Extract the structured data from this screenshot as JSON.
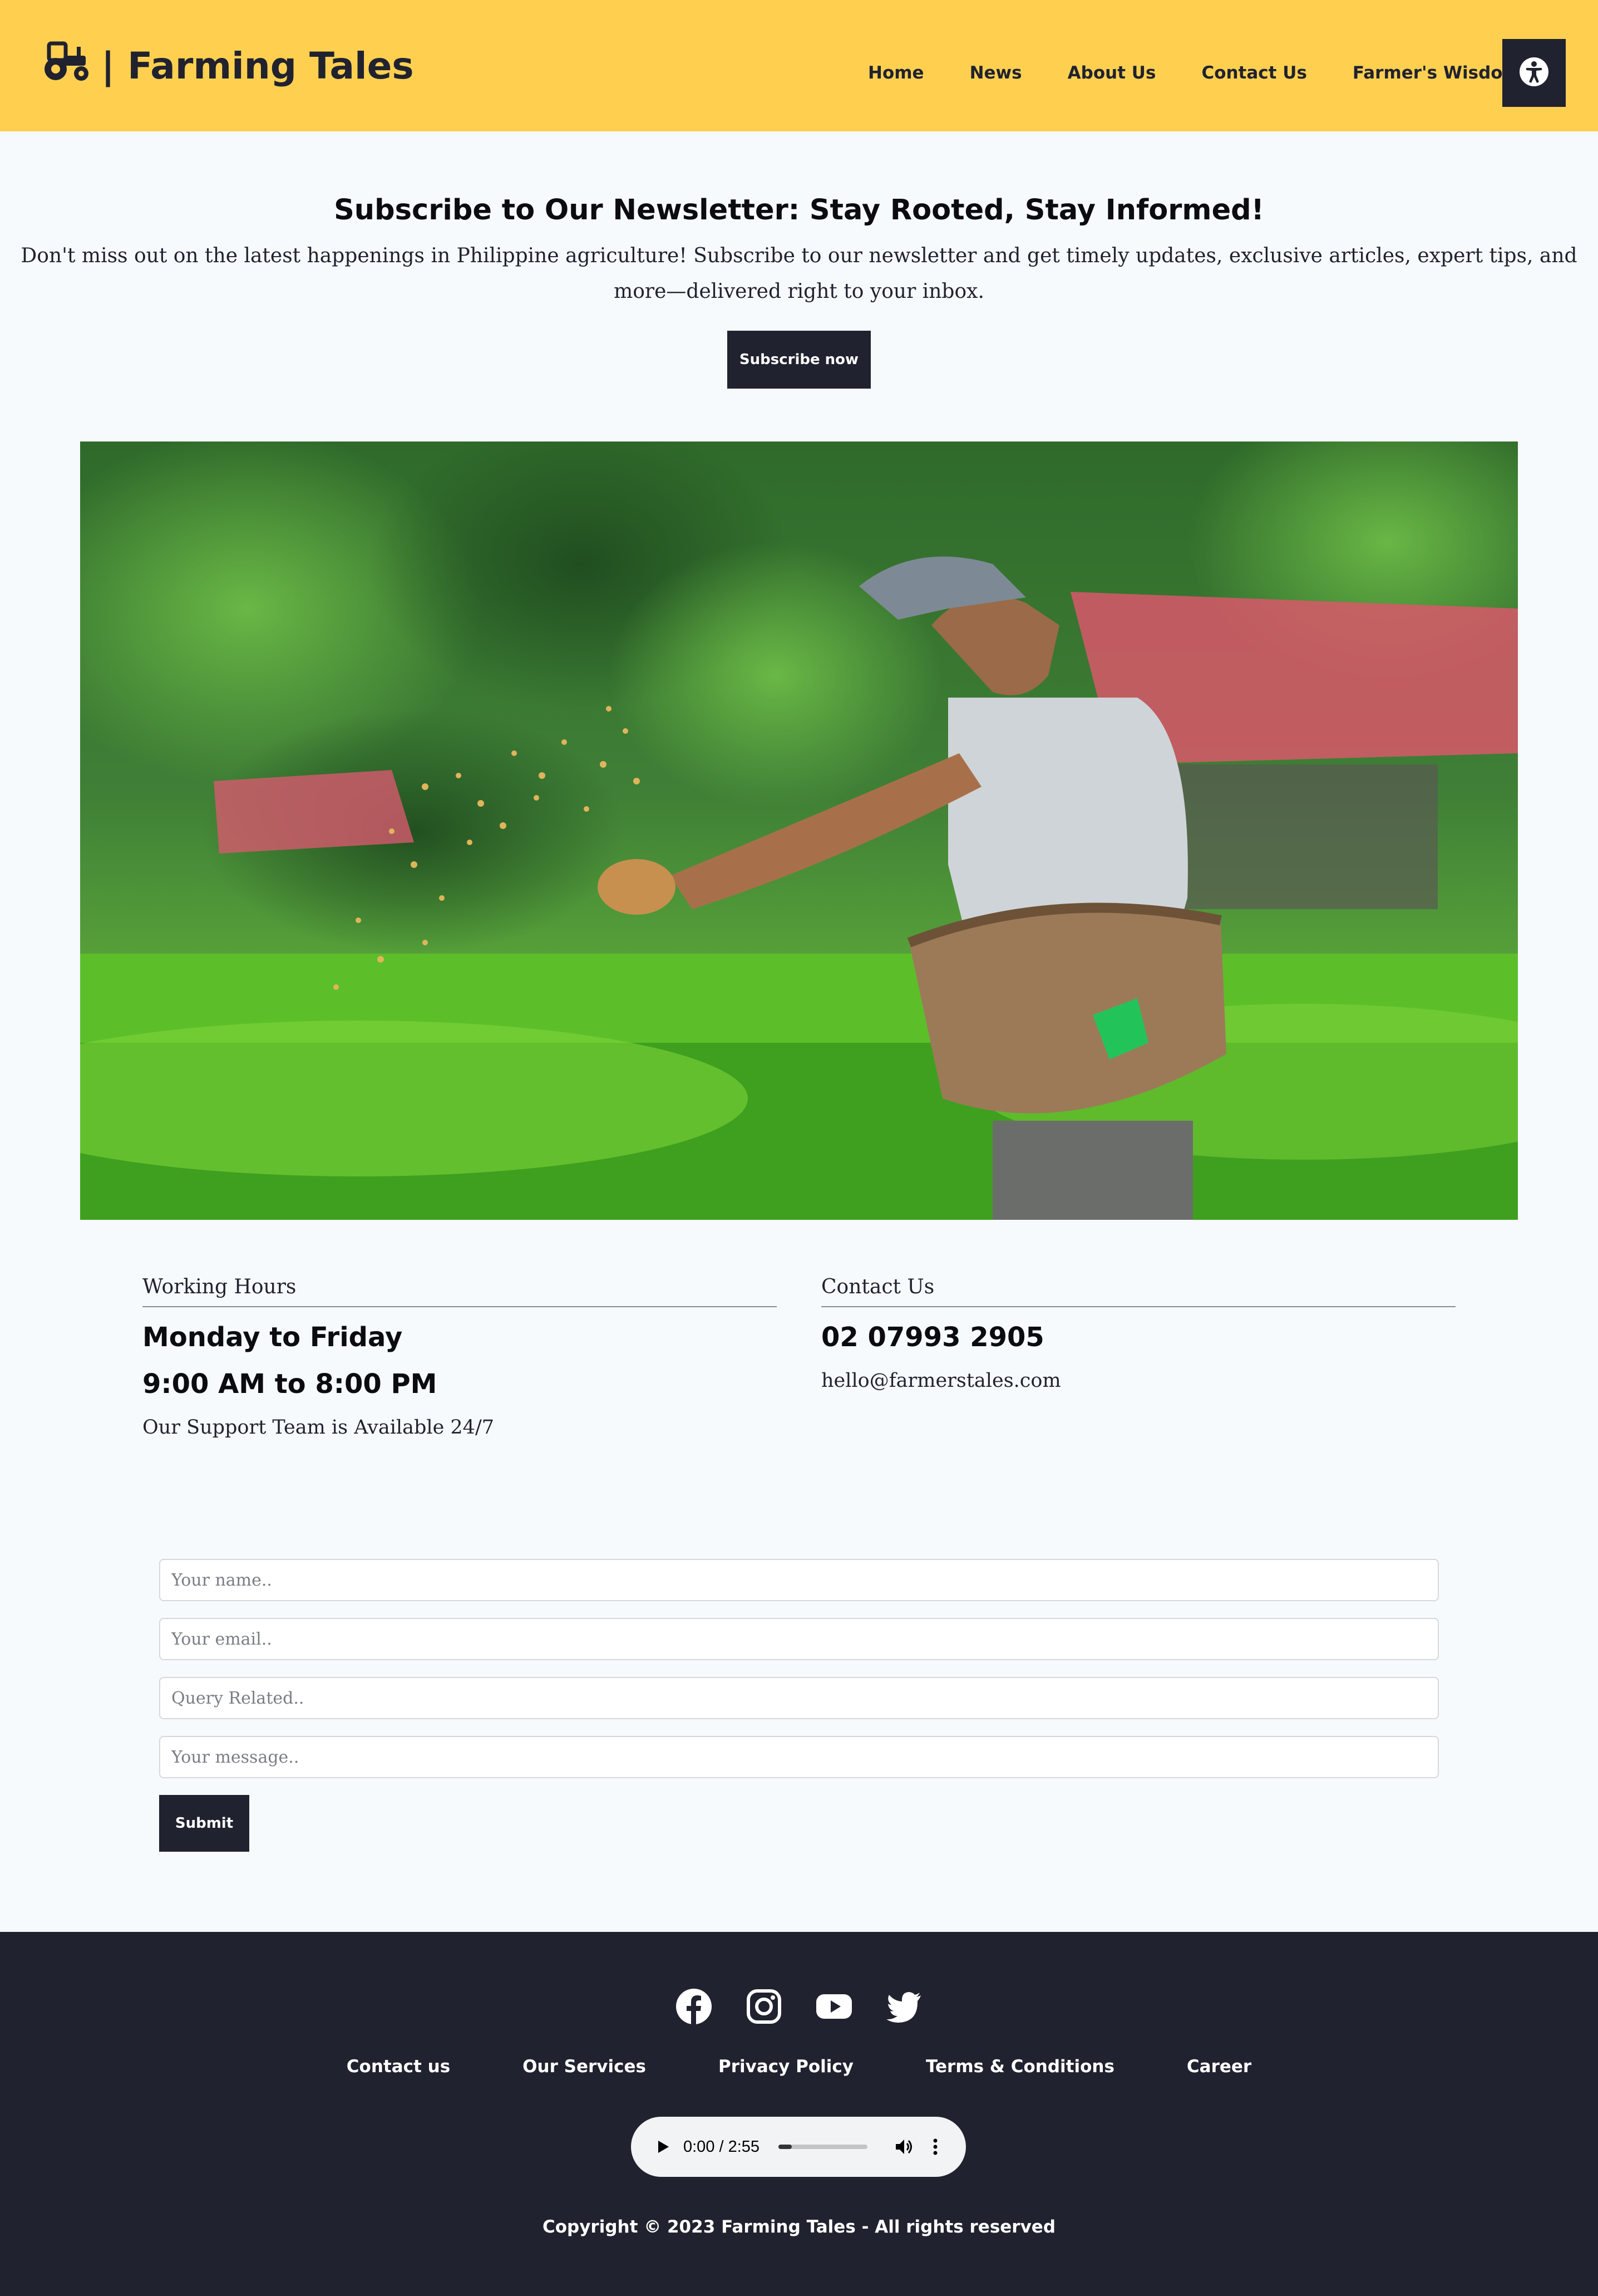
{
  "header": {
    "brand": "| Farming Tales",
    "logo_icon": "tractor-icon",
    "nav": [
      "Home",
      "News",
      "About Us",
      "Contact Us",
      "Farmer's Wisdom"
    ],
    "accessibility_icon": "accessibility-icon"
  },
  "newsletter": {
    "title": "Subscribe to Our Newsletter: Stay Rooted, Stay Informed!",
    "text": "Don't miss out on the latest happenings in Philippine agriculture! Subscribe to our newsletter and get timely updates, exclusive articles, expert tips, and more—delivered right to your inbox.",
    "button": "Subscribe now"
  },
  "hours": {
    "label": "Working Hours",
    "days": "Monday to Friday",
    "time": "9:00 AM to 8:00 PM",
    "note": "Our Support Team is Available 24/7"
  },
  "contact": {
    "label": "Contact Us",
    "phone": "02 07993 2905",
    "email": "hello@farmerstales.com"
  },
  "form": {
    "name_placeholder": "Your name..",
    "email_placeholder": "Your email..",
    "query_placeholder": "Query Related..",
    "message_placeholder": "Your message..",
    "submit": "Submit"
  },
  "footer": {
    "social_icons": [
      "facebook-icon",
      "instagram-icon",
      "youtube-icon",
      "twitter-icon"
    ],
    "links": [
      "Contact us",
      "Our Services",
      "Privacy Policy",
      "Terms & Conditions",
      "Career"
    ],
    "audio": {
      "time": "0:00 / 2:55",
      "progress": 0.0
    },
    "copyright": "Copyright © 2023 Farming Tales - All rights reserved"
  },
  "colors": {
    "header_bg": "#ffd050",
    "dark": "#21222f",
    "page_bg": "#f6fafd"
  }
}
